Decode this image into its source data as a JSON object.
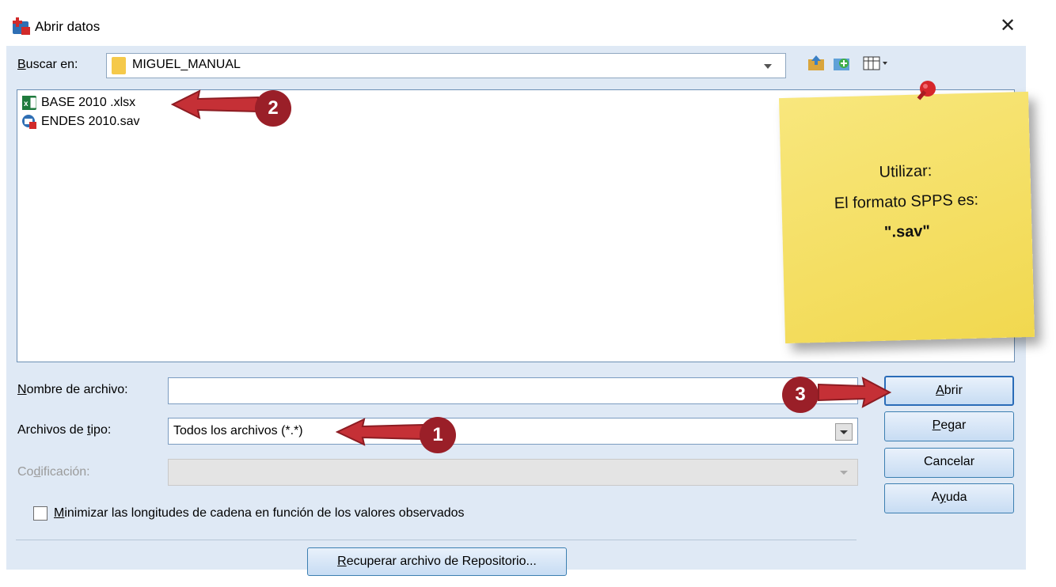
{
  "window": {
    "title": "Abrir datos",
    "close_glyph": "✕"
  },
  "lookin": {
    "label_u": "B",
    "label_rest": "uscar en:",
    "folder": "MIGUEL_MANUAL"
  },
  "files": [
    {
      "name": "BASE 2010 .xlsx",
      "icon": "excel-file-icon"
    },
    {
      "name": "ENDES 2010.sav",
      "icon": "spss-data-file-icon"
    }
  ],
  "fields": {
    "filename_label_u": "N",
    "filename_label_rest": "ombre de archivo:",
    "filename_value": "",
    "filetype_label_pre": "Archivos de ",
    "filetype_label_u": "t",
    "filetype_label_rest": "ipo:",
    "filetype_value": "Todos los archivos (*.*)",
    "encoding_label_pre": "Co",
    "encoding_label_u": "d",
    "encoding_label_rest": "ificación:"
  },
  "checkbox": {
    "label_u": "M",
    "label_rest": "inimizar las longitudes de cadena en función de los valores observados",
    "checked": false
  },
  "buttons": {
    "open_u": "A",
    "open_rest": "brir",
    "paste_u": "P",
    "paste_rest": "egar",
    "cancel": "Cancelar",
    "help_pre": "A",
    "help_u": "y",
    "help_rest": "uda",
    "repo_u": "R",
    "repo_rest": "ecuperar archivo de Repositorio..."
  },
  "annotations": {
    "badge1": "1",
    "badge2": "2",
    "badge3": "3"
  },
  "note": {
    "line1": "Utilizar:",
    "line2": "El formato SPPS es:",
    "line3": "\".sav\""
  },
  "colors": {
    "accent": "#2a6cb8",
    "badge": "#9a1f28",
    "note": "#f5e066"
  }
}
